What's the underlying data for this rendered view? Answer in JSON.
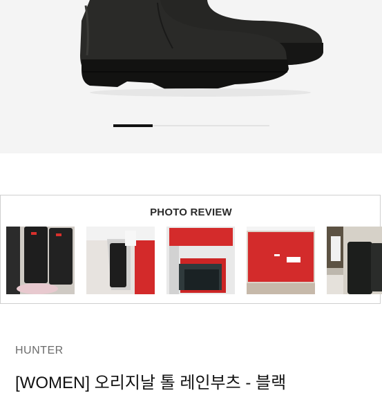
{
  "gallery": {
    "image_alt": "black rain boot product photo",
    "current_index": 1,
    "pager_fraction": 0.25
  },
  "photo_review": {
    "heading": "PHOTO REVIEW",
    "thumbnails": [
      {
        "name": "review-thumb-1"
      },
      {
        "name": "review-thumb-2"
      },
      {
        "name": "review-thumb-3"
      },
      {
        "name": "review-thumb-4"
      },
      {
        "name": "review-thumb-5"
      }
    ]
  },
  "product": {
    "brand": "HUNTER",
    "title": "[WOMEN] 오리지날 톨 레인부츠 - 블랙"
  },
  "colors": {
    "hero_bg": "#f4f4f4",
    "boot": "#1f1f1d",
    "hunter_red": "#d9302c"
  }
}
